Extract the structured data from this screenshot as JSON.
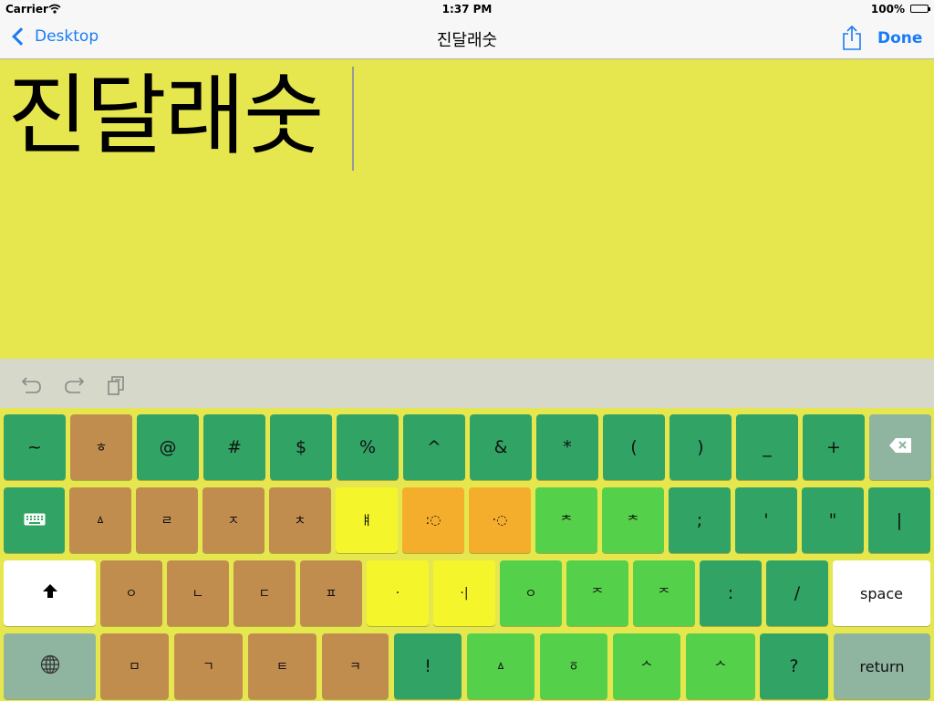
{
  "status_bar": {
    "carrier": "Carrier",
    "time": "1:37 PM",
    "battery": "100%"
  },
  "nav": {
    "back_label": "Desktop",
    "title": "진달래숫",
    "done_label": "Done"
  },
  "editor": {
    "text": "진달래숫"
  },
  "toolbar": {
    "icons": [
      "undo-icon",
      "redo-icon",
      "copy-icon"
    ]
  },
  "colors": {
    "background": "#e6e74e",
    "dark_green": "#31a465",
    "brown": "#c08d4e",
    "light_green": "#54d04a",
    "yellow": "#f5f52c",
    "orange": "#f5ae2c",
    "gray_green": "#8fb4a0",
    "white": "#ffffff",
    "link_blue": "#1a7cf5"
  },
  "keyboard": {
    "rows": [
      [
        {
          "label": "~",
          "color": "dark_green"
        },
        {
          "label": "ㅎ",
          "color": "brown"
        },
        {
          "label": "@",
          "color": "dark_green"
        },
        {
          "label": "#",
          "color": "dark_green"
        },
        {
          "label": "$",
          "color": "dark_green"
        },
        {
          "label": "%",
          "color": "dark_green"
        },
        {
          "label": "^",
          "color": "dark_green"
        },
        {
          "label": "&",
          "color": "dark_green"
        },
        {
          "label": "*",
          "color": "dark_green"
        },
        {
          "label": "(",
          "color": "dark_green"
        },
        {
          "label": ")",
          "color": "dark_green"
        },
        {
          "label": "_",
          "color": "dark_green"
        },
        {
          "label": "+",
          "color": "dark_green"
        },
        {
          "label": "",
          "color": "gray_green",
          "icon": "backspace-icon"
        }
      ],
      [
        {
          "label": "",
          "color": "dark_green",
          "icon": "keyboard-icon"
        },
        {
          "label": "ㅿ",
          "color": "brown"
        },
        {
          "label": "ㄹ",
          "color": "brown"
        },
        {
          "label": "ㅈ",
          "color": "brown"
        },
        {
          "label": "ㅊ",
          "color": "brown"
        },
        {
          "label": "ㅒ",
          "color": "yellow"
        },
        {
          "label": ":◌",
          "color": "orange"
        },
        {
          "label": "·◌",
          "color": "orange"
        },
        {
          "label": "ᄎ",
          "color": "light_green"
        },
        {
          "label": "ᄎ",
          "color": "light_green"
        },
        {
          "label": ";",
          "color": "dark_green"
        },
        {
          "label": "'",
          "color": "dark_green"
        },
        {
          "label": "\"",
          "color": "dark_green"
        },
        {
          "label": "|",
          "color": "dark_green"
        }
      ],
      [
        {
          "label": "",
          "color": "white",
          "icon": "shift-icon"
        },
        {
          "label": "ㅇ",
          "color": "brown"
        },
        {
          "label": "ㄴ",
          "color": "brown"
        },
        {
          "label": "ㄷ",
          "color": "brown"
        },
        {
          "label": "ㅍ",
          "color": "brown"
        },
        {
          "label": "·",
          "color": "yellow"
        },
        {
          "label": "·|",
          "color": "yellow"
        },
        {
          "label": "ㅇ",
          "color": "light_green"
        },
        {
          "label": "ᄌ",
          "color": "light_green"
        },
        {
          "label": "ᄌ",
          "color": "light_green"
        },
        {
          "label": ":",
          "color": "dark_green"
        },
        {
          "label": "/",
          "color": "dark_green"
        },
        {
          "label": "space",
          "color": "white"
        }
      ],
      [
        {
          "label": "",
          "color": "gray_green",
          "icon": "globe-icon"
        },
        {
          "label": "ㅁ",
          "color": "brown"
        },
        {
          "label": "ㄱ",
          "color": "brown"
        },
        {
          "label": "ㅌ",
          "color": "brown"
        },
        {
          "label": "ㅋ",
          "color": "brown"
        },
        {
          "label": "!",
          "color": "dark_green"
        },
        {
          "label": "ㅿ",
          "color": "light_green"
        },
        {
          "label": "ㆆ",
          "color": "light_green"
        },
        {
          "label": "ᄉ",
          "color": "light_green"
        },
        {
          "label": "ᄉ",
          "color": "light_green"
        },
        {
          "label": "?",
          "color": "dark_green"
        },
        {
          "label": "return",
          "color": "gray_green"
        }
      ]
    ]
  }
}
